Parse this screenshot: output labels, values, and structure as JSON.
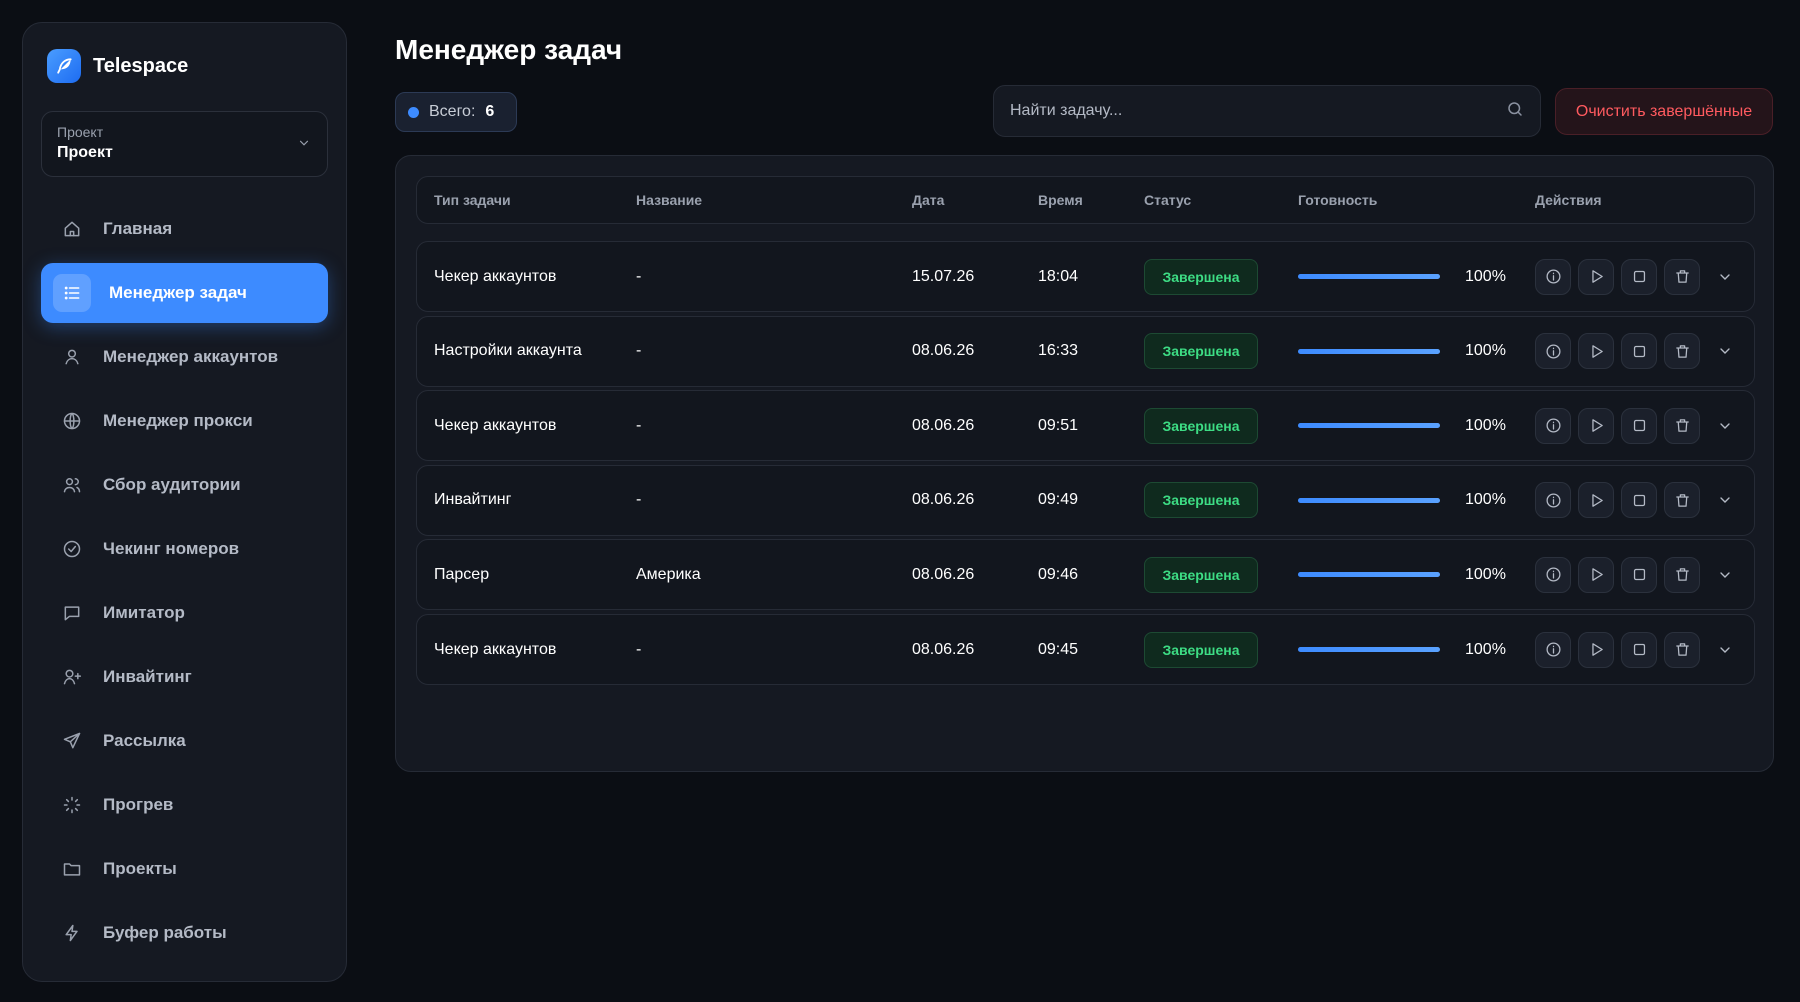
{
  "app": {
    "name": "Telespace"
  },
  "sidebar": {
    "project": {
      "label": "Проект",
      "value": "Проект"
    },
    "items": [
      {
        "label": "Главная",
        "icon": "home-icon",
        "active": false
      },
      {
        "label": "Менеджер задач",
        "icon": "list-icon",
        "active": true
      },
      {
        "label": "Менеджер аккаунтов",
        "icon": "user-icon",
        "active": false
      },
      {
        "label": "Менеджер прокси",
        "icon": "globe-icon",
        "active": false
      },
      {
        "label": "Сбор аудитории",
        "icon": "users-icon",
        "active": false
      },
      {
        "label": "Чекинг номеров",
        "icon": "check-circle-icon",
        "active": false
      },
      {
        "label": "Имитатор",
        "icon": "message-icon",
        "active": false
      },
      {
        "label": "Инвайтинг",
        "icon": "user-plus-icon",
        "active": false
      },
      {
        "label": "Рассылка",
        "icon": "send-icon",
        "active": false
      },
      {
        "label": "Прогрев",
        "icon": "loader-icon",
        "active": false
      },
      {
        "label": "Проекты",
        "icon": "folder-icon",
        "active": false
      },
      {
        "label": "Буфер работы",
        "icon": "bolt-icon",
        "active": false
      }
    ]
  },
  "main": {
    "title": "Менеджер задач",
    "total": {
      "label": "Всего:",
      "count": "6"
    },
    "search": {
      "placeholder": "Найти задачу...",
      "value": ""
    },
    "clear_button": "Очистить завершённые",
    "table": {
      "headers": {
        "type": "Тип задачи",
        "name": "Название",
        "date": "Дата",
        "time": "Время",
        "status": "Статус",
        "ready": "Готовность",
        "actions": "Действия"
      },
      "rows": [
        {
          "type": "Чекер аккаунтов",
          "name": "-",
          "date": "15.07.26",
          "time": "18:04",
          "status": "Завершена",
          "progress": 100,
          "percent": "100%"
        },
        {
          "type": "Настройки аккаунта",
          "name": "-",
          "date": "08.06.26",
          "time": "16:33",
          "status": "Завершена",
          "progress": 100,
          "percent": "100%"
        },
        {
          "type": "Чекер аккаунтов",
          "name": "-",
          "date": "08.06.26",
          "time": "09:51",
          "status": "Завершена",
          "progress": 100,
          "percent": "100%"
        },
        {
          "type": "Инвайтинг",
          "name": "-",
          "date": "08.06.26",
          "time": "09:49",
          "status": "Завершена",
          "progress": 100,
          "percent": "100%"
        },
        {
          "type": "Парсер",
          "name": "Америка",
          "date": "08.06.26",
          "time": "09:46",
          "status": "Завершена",
          "progress": 100,
          "percent": "100%"
        },
        {
          "type": "Чекер аккаунтов",
          "name": "-",
          "date": "08.06.26",
          "time": "09:45",
          "status": "Завершена",
          "progress": 100,
          "percent": "100%"
        }
      ]
    }
  },
  "colors": {
    "background": "#0b0e14",
    "panel": "#151922",
    "accent": "#3d8bff",
    "success": "#3ddc84",
    "danger": "#ff5a5f"
  }
}
